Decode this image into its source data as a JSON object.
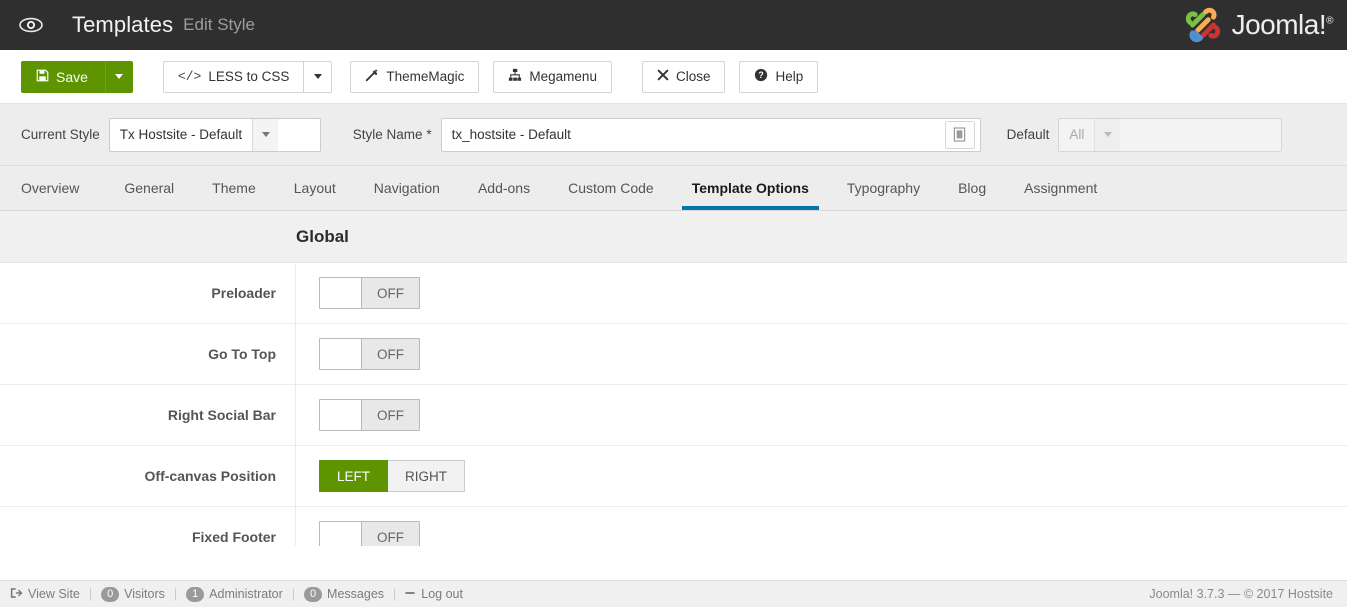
{
  "header": {
    "eye_icon": "eye-icon",
    "title": "Templates",
    "subtitle": "Edit Style",
    "brand": "Joomla!",
    "brand_sup": "®"
  },
  "toolbar": {
    "save_label": "Save",
    "save_icon": "floppy-disk-icon",
    "less_to_css_label": "LESS to CSS",
    "less_to_css_icon": "code-icon",
    "thememagic_label": "ThemeMagic",
    "thememagic_icon": "magic-wand-icon",
    "megamenu_label": "Megamenu",
    "megamenu_icon": "sitemap-icon",
    "close_label": "Close",
    "close_icon": "x-icon",
    "help_label": "Help",
    "help_icon": "question-circle-icon"
  },
  "stylebar": {
    "current_style_label": "Current Style",
    "current_style_value": "Tx Hostsite - Default",
    "style_name_label": "Style Name",
    "style_name_required": "*",
    "style_name_value": "tx_hostsite - Default",
    "style_name_icon": "article-icon",
    "default_label": "Default",
    "default_placeholder": "All"
  },
  "tabs": [
    {
      "label": "Overview",
      "active": false
    },
    {
      "label": "General",
      "active": false
    },
    {
      "label": "Theme",
      "active": false
    },
    {
      "label": "Layout",
      "active": false
    },
    {
      "label": "Navigation",
      "active": false
    },
    {
      "label": "Add-ons",
      "active": false
    },
    {
      "label": "Custom Code",
      "active": false
    },
    {
      "label": "Template Options",
      "active": true
    },
    {
      "label": "Typography",
      "active": false
    },
    {
      "label": "Blog",
      "active": false
    },
    {
      "label": "Assignment",
      "active": false
    }
  ],
  "section": {
    "title": "Global"
  },
  "rows": [
    {
      "label": "Preloader",
      "type": "toggle",
      "state": "OFF"
    },
    {
      "label": "Go To Top",
      "type": "toggle",
      "state": "OFF"
    },
    {
      "label": "Right Social Bar",
      "type": "toggle",
      "state": "OFF"
    },
    {
      "label": "Off-canvas Position",
      "type": "pair",
      "active_option": "LEFT",
      "inactive_option": "RIGHT"
    },
    {
      "label": "Fixed Footer",
      "type": "toggle",
      "state": "OFF"
    }
  ],
  "statusbar": {
    "view_site": "View Site",
    "view_site_icon": "external-link-icon",
    "visitors_count": "0",
    "visitors_label": "Visitors",
    "administrator_count": "1",
    "administrator_label": "Administrator",
    "messages_count": "0",
    "messages_label": "Messages",
    "logout_label": "Log out",
    "logout_icon": "minus-icon",
    "copyright": "Joomla! 3.7.3  —  © 2017 Hostsite"
  },
  "colors": {
    "accent_green": "#5e9400",
    "accent_blue": "#0973b0",
    "header_dark": "#2f2f2f"
  }
}
